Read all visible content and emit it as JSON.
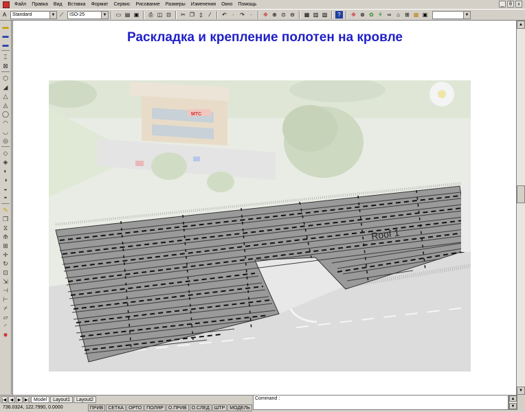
{
  "menu": {
    "items": [
      "Файл",
      "Правка",
      "Вид",
      "Вставка",
      "Формат",
      "Сервис",
      "Рисование",
      "Размеры",
      "Изменения",
      "Окно",
      "Помощь"
    ],
    "window_controls": [
      "_",
      "θ",
      "x"
    ]
  },
  "toolbar": {
    "text_style": "Standard",
    "dim_style": "ISO-25",
    "dropdown_right": ""
  },
  "slide": {
    "title": "Раскладка и крепление полотен на кровле",
    "roof_label": "Roof 1",
    "building_sign": "МТС"
  },
  "tabs": [
    "Model",
    "Layout1",
    "Layout2"
  ],
  "active_tab": "Model",
  "command": {
    "label": "Command :"
  },
  "status": {
    "coords": "736.0324,  122.7990, 0.0000",
    "buttons": [
      "ПРИВ",
      "СЕТКА",
      "ОРТО",
      "ПОЛЯР",
      "О.ПРИВ",
      "О.СЛЕД",
      "ШТР",
      "МОДЕЛЬ"
    ]
  },
  "colors": {
    "title": "#1f1fc8",
    "ui_face": "#d4d0c8"
  }
}
